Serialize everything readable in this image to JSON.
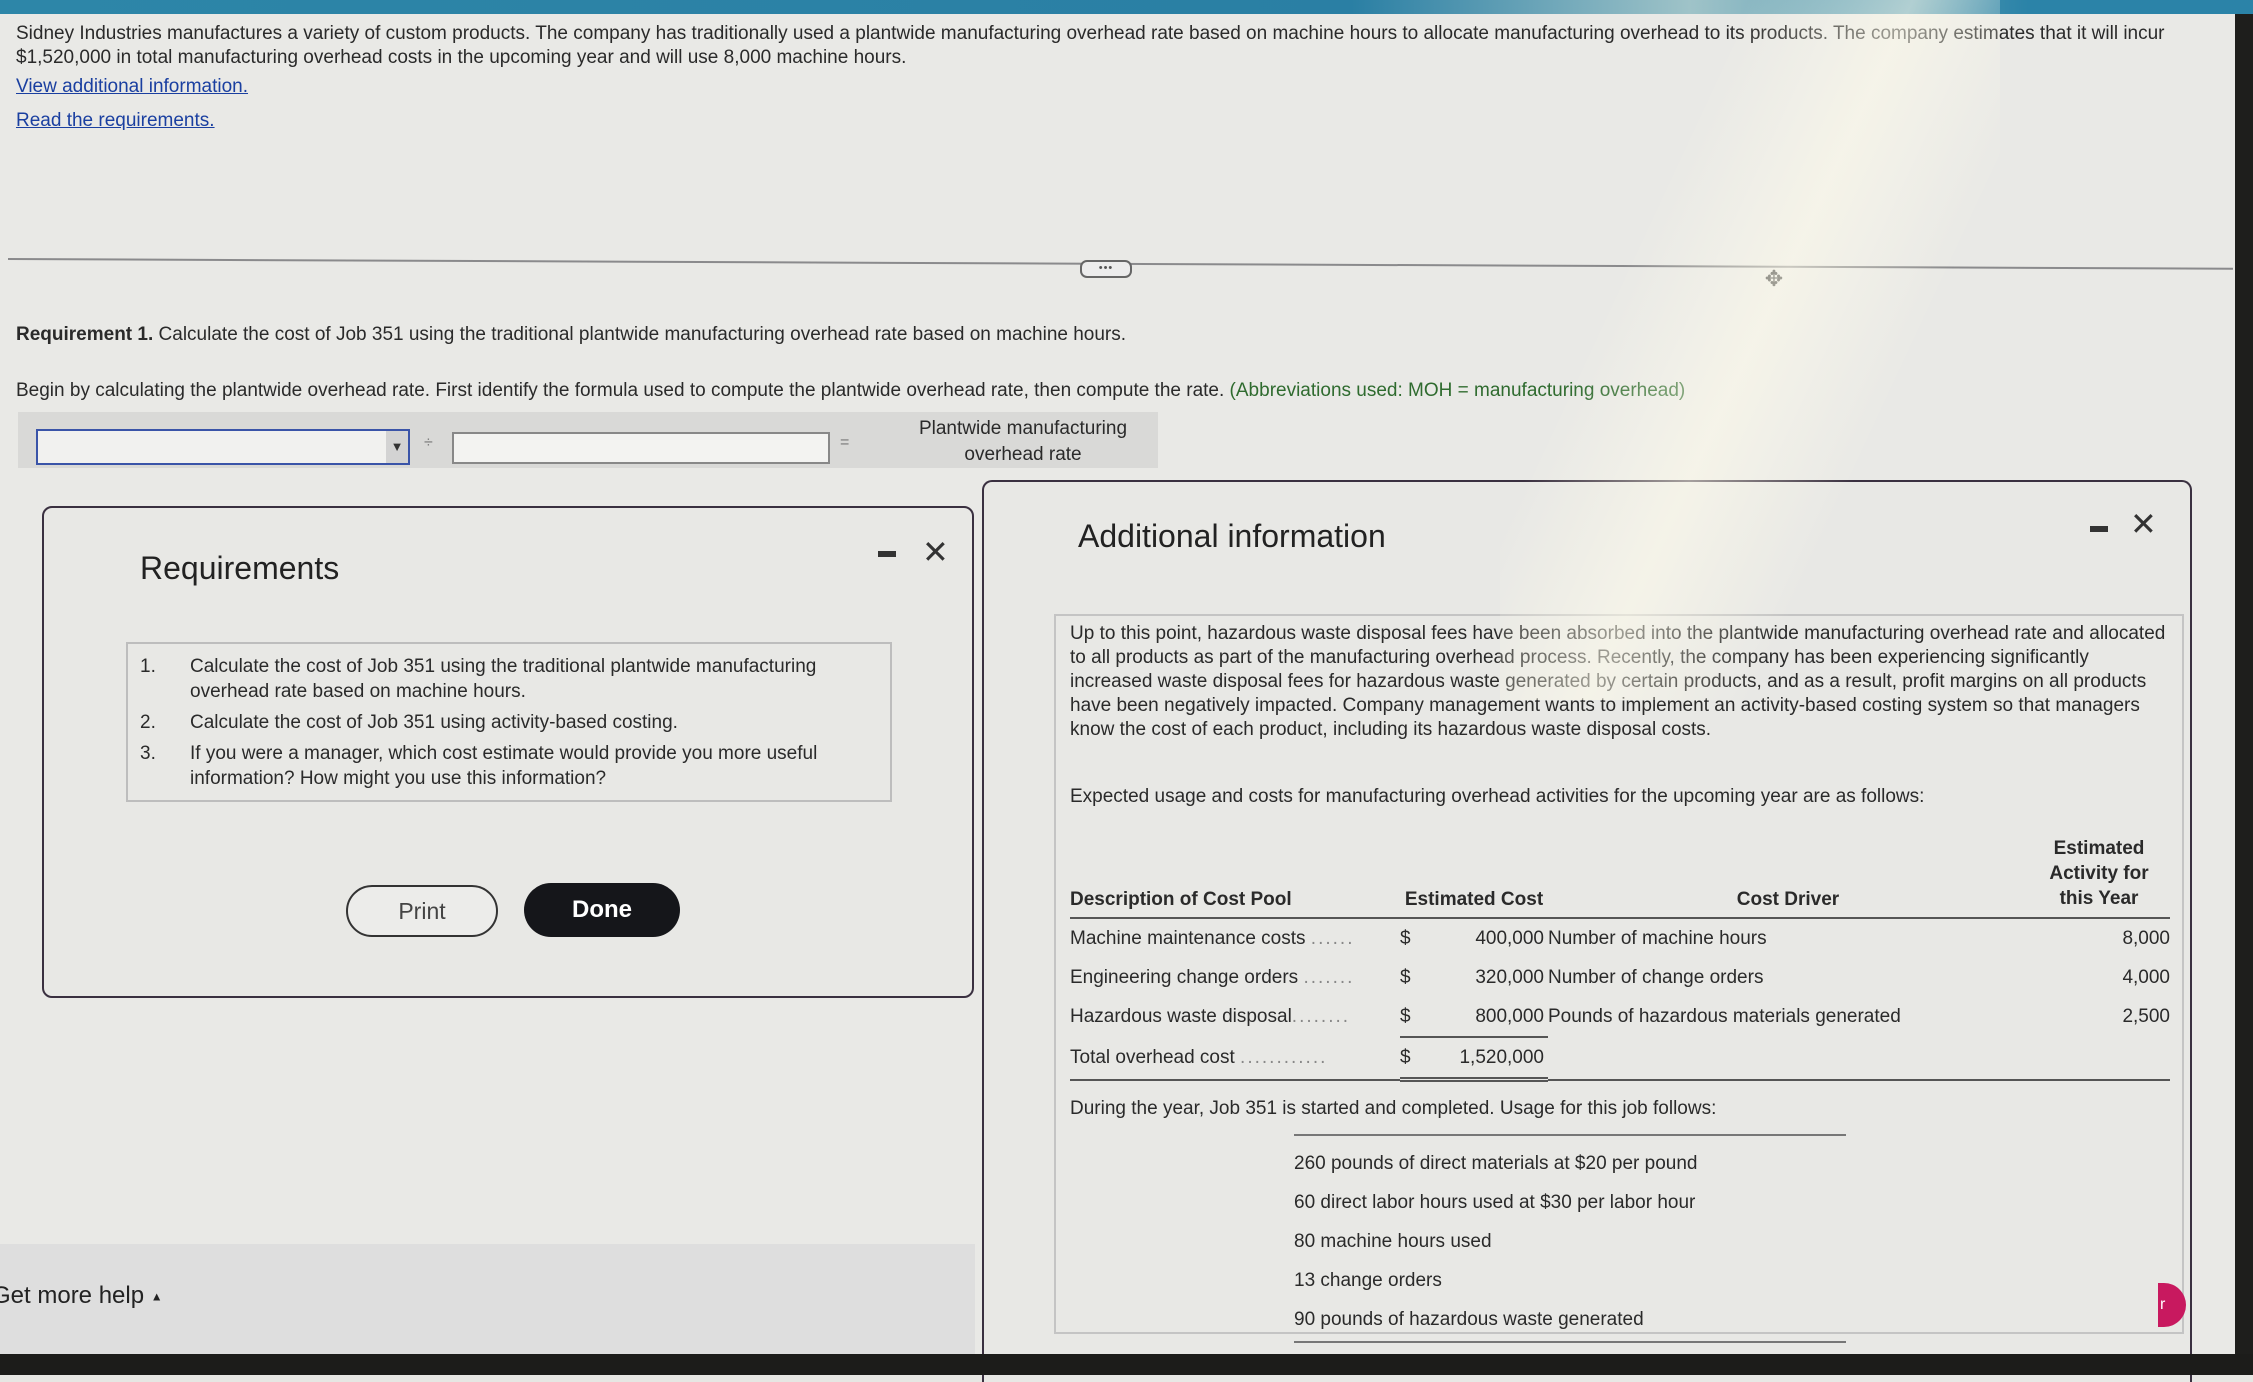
{
  "intro": {
    "text": "Sidney Industries manufactures a variety of custom products. The company has traditionally used a plantwide manufacturing overhead rate based on machine hours to allocate manufacturing overhead to its products. The company estimates that it will incur $1,520,000 in total manufacturing overhead costs in the upcoming year and will use 8,000 machine hours.",
    "view_additional_link": "View additional information.",
    "read_requirements_link": "Read the requirements."
  },
  "divider": {
    "handle_label": "•••"
  },
  "requirement1": {
    "label": "Requirement 1.",
    "text": " Calculate the cost of Job 351 using the traditional plantwide manufacturing overhead rate based on machine hours."
  },
  "instruction": {
    "text": "Begin by calculating the plantwide overhead rate. First identify the formula used to compute the plantwide overhead rate, then compute the rate.",
    "abbrev": " (Abbreviations used: MOH = manufacturing overhead)"
  },
  "formula": {
    "select_value": "",
    "select_arrow": "▼",
    "divide_sign": "÷",
    "input_value": "",
    "equals_sign": "=",
    "result_label_line1": "Plantwide manufacturing",
    "result_label_line2": "overhead rate"
  },
  "requirements_modal": {
    "title": "Requirements",
    "minimize": "—",
    "close": "✕",
    "items": [
      {
        "num": "1.",
        "text": "Calculate the cost of Job 351 using the traditional plantwide manufacturing overhead rate based on machine hours."
      },
      {
        "num": "2.",
        "text": "Calculate the cost of Job 351 using activity-based costing."
      },
      {
        "num": "3.",
        "text": "If you were a manager, which cost estimate would provide you more useful information? How might you use this information?"
      }
    ],
    "print_label": "Print",
    "done_label": "Done"
  },
  "additional_modal": {
    "title": "Additional information",
    "close": "✕",
    "paragraph": "Up to this point, hazardous waste disposal fees have been absorbed into the plantwide manufacturing overhead rate and allocated to all products as part of the manufacturing overhead process. Recently, the company has been experiencing significantly increased waste disposal fees for hazardous waste generated by certain products, and as a result, profit margins on all products have been negatively impacted. Company management wants to implement an activity-based costing system so that managers know the cost of each product, including its hazardous waste disposal costs.",
    "expected": "Expected usage and costs for manufacturing overhead activities for the upcoming year are as follows:",
    "table": {
      "headers": {
        "pool": "Description of Cost Pool",
        "cost": "Estimated Cost",
        "driver": "Cost Driver",
        "activity_line1": "Estimated",
        "activity_line2": "Activity for",
        "activity_line3": "this Year"
      },
      "rows": [
        {
          "pool": "Machine maintenance costs",
          "dots": "......",
          "currency": "$",
          "cost": "400,000",
          "driver": "Number of machine hours",
          "activity": "8,000"
        },
        {
          "pool": "Engineering change orders",
          "dots": ".......",
          "currency": "$",
          "cost": "320,000",
          "driver": "Number of change orders",
          "activity": "4,000"
        },
        {
          "pool": "Hazardous waste disposal",
          "dots": "........",
          "currency": "$",
          "cost": "800,000",
          "driver": "Pounds of hazardous materials generated",
          "activity": "2,500"
        }
      ],
      "total": {
        "pool": "Total overhead cost",
        "dots": "............",
        "currency": "$",
        "cost": "1,520,000"
      }
    },
    "during": "During the year, Job 351 is started and completed. Usage for this job follows:",
    "usage": [
      "260 pounds of direct materials at $20 per pound",
      "60 direct labor hours used at $30 per labor hour",
      "80 machine hours used",
      "13 change orders",
      "90 pounds of hazardous waste generated"
    ]
  },
  "footer": {
    "help_label": "Get more help",
    "help_caret": "▲"
  },
  "colors": {
    "accent_link": "#1a3fa0",
    "done_button": "#15161a",
    "fab": "#c8195f",
    "topbar": "#2a7fa4"
  }
}
